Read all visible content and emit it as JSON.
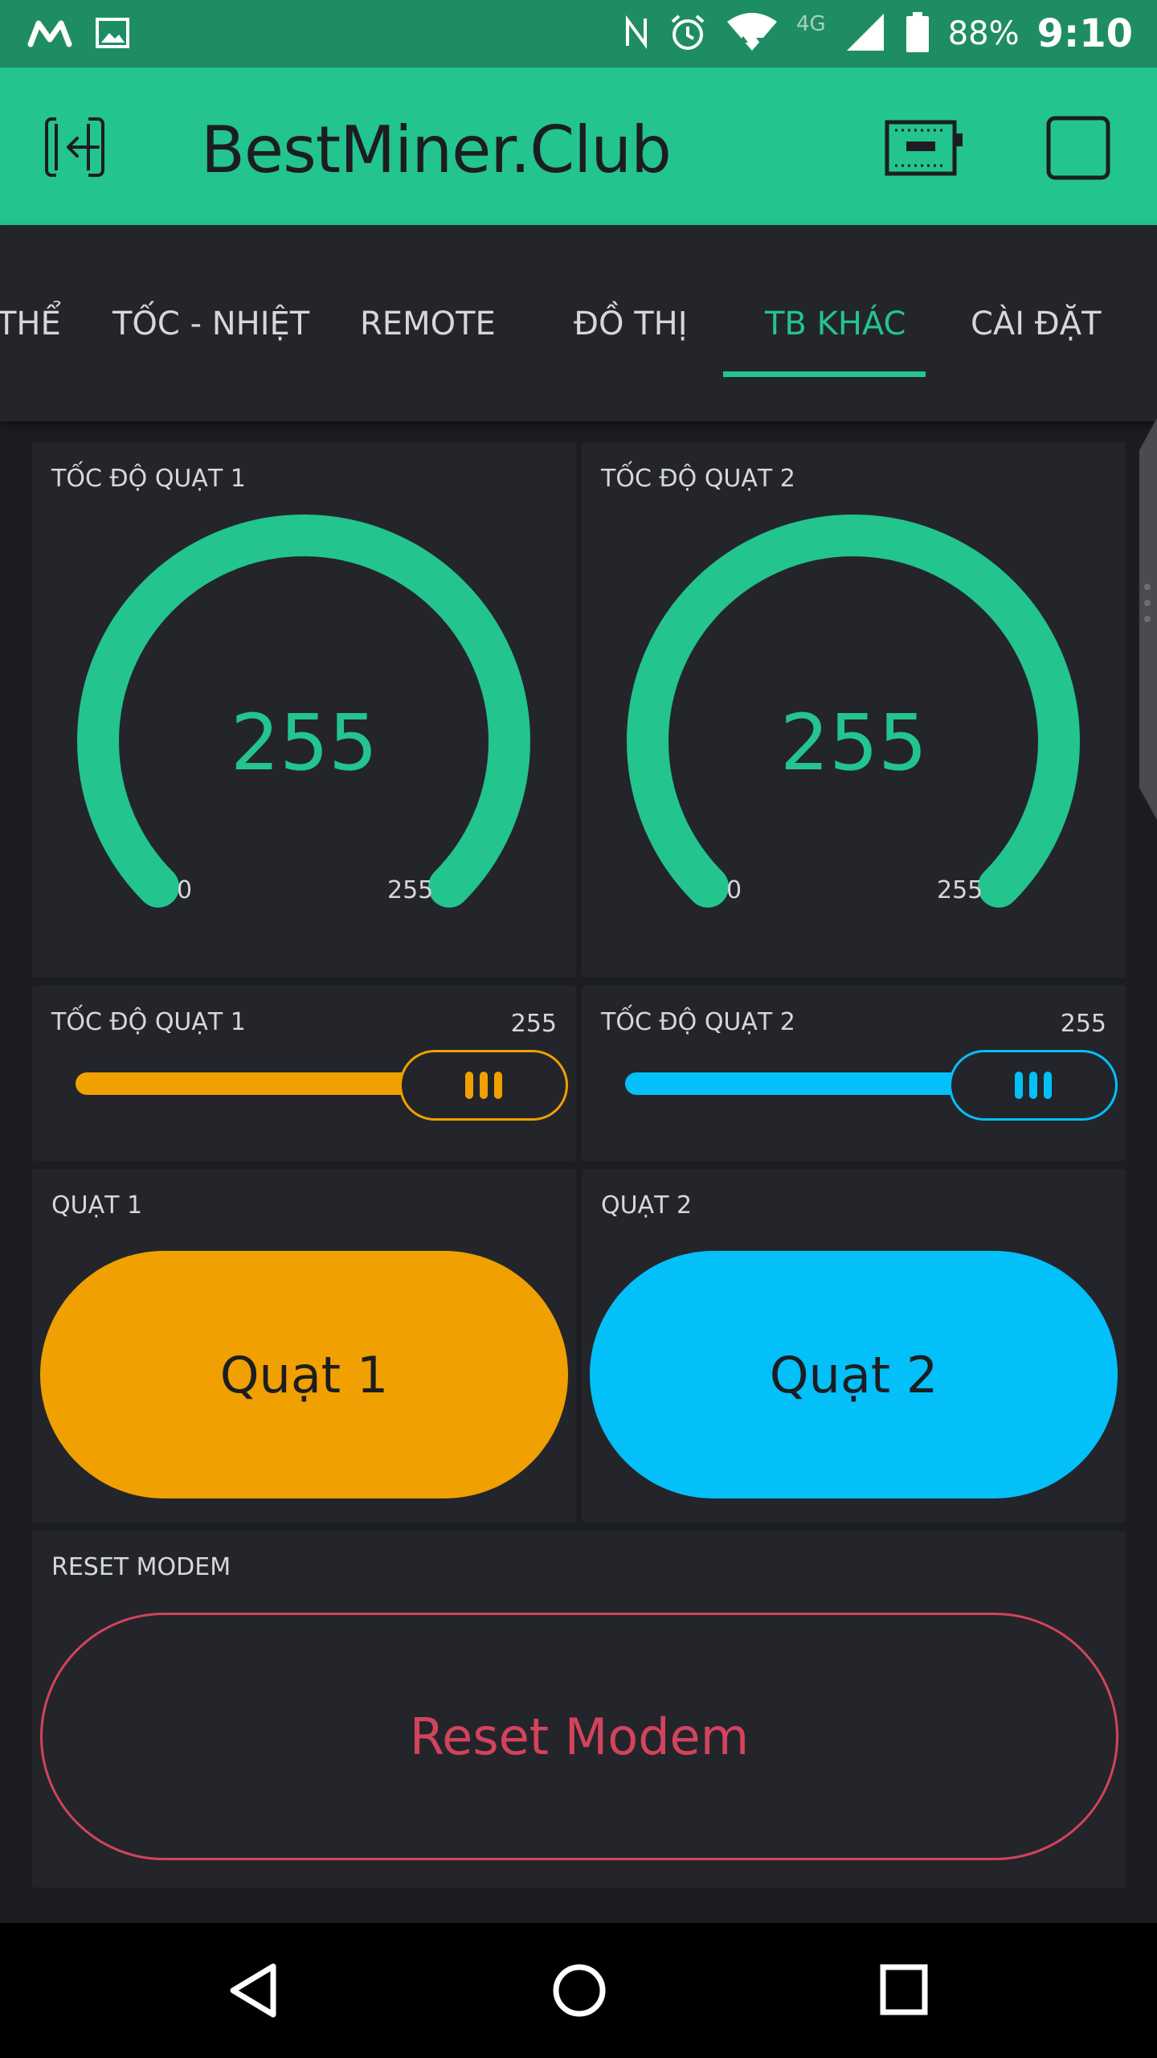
{
  "status_bar": {
    "network_type": "4G",
    "battery": "88%",
    "time": "9:10"
  },
  "app_bar": {
    "title": "BestMiner.Club"
  },
  "tabs": [
    {
      "label": "THỂ"
    },
    {
      "label": "TỐC - NHIỆT"
    },
    {
      "label": "REMOTE"
    },
    {
      "label": "ĐỒ THỊ"
    },
    {
      "label": "TB KHÁC",
      "active": true
    },
    {
      "label": "CÀI ĐẶT"
    }
  ],
  "gauges": [
    {
      "title": "TỐC ĐỘ QUẠT 1",
      "value": "255",
      "min": "0",
      "max": "255",
      "fraction": 1.0,
      "color": "#23c48e"
    },
    {
      "title": "TỐC ĐỘ QUẠT 2",
      "value": "255",
      "min": "0",
      "max": "255",
      "fraction": 1.0,
      "color": "#23c48e"
    }
  ],
  "sliders": [
    {
      "title": "TỐC ĐỘ QUẠT 1",
      "value": "255",
      "fraction": 1.0,
      "color": "#f0a000"
    },
    {
      "title": "TỐC ĐỘ QUẠT 2",
      "value": "255",
      "fraction": 1.0,
      "color": "#04c0f8"
    }
  ],
  "buttons": [
    {
      "title": "QUẠT 1",
      "label": "Quạt 1",
      "color": "#f0a000"
    },
    {
      "title": "QUẠT 2",
      "label": "Quạt 2",
      "color": "#04c0f8"
    }
  ],
  "reset": {
    "title": "RESET MODEM",
    "label": "Reset Modem",
    "color": "#d3435c"
  },
  "colors": {
    "accent": "#23c48e",
    "status_bar": "#1f8d63",
    "background": "#1c1d22",
    "panel": "#23252b"
  },
  "icons": {
    "status_left": [
      "m-logo-icon",
      "image-icon"
    ],
    "status_right": [
      "nfc-icon",
      "alarm-icon",
      "wifi-icon",
      "signal-icon",
      "battery-icon"
    ],
    "app_bar": [
      "exit-icon",
      "device-board-icon",
      "square-icon"
    ],
    "nav": [
      "back-icon",
      "home-icon",
      "recents-icon"
    ]
  }
}
